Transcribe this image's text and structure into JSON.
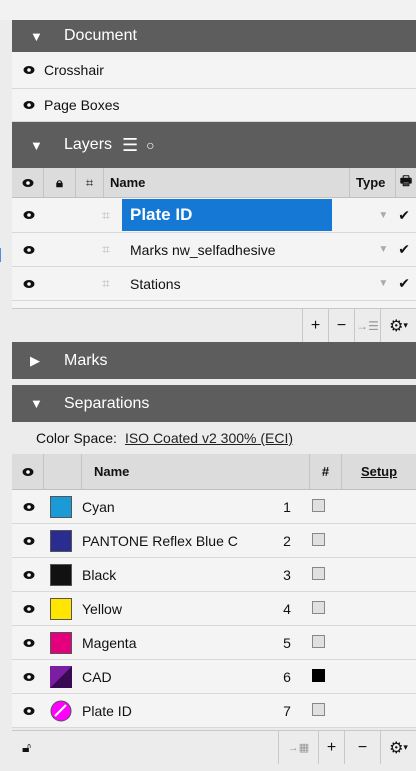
{
  "document": {
    "title": "Document",
    "items": [
      "Crosshair",
      "Page Boxes"
    ]
  },
  "layers": {
    "title": "Layers",
    "columns": {
      "name": "Name",
      "type": "Type"
    },
    "rows": [
      {
        "name": "Plate ID",
        "selected": true
      },
      {
        "name": "Marks nw_selfadhesive",
        "selected": false
      },
      {
        "name": "Stations",
        "selected": false
      }
    ],
    "toolbar": {
      "add": "+",
      "remove": "−",
      "gear": "⚙"
    }
  },
  "marks": {
    "title": "Marks"
  },
  "separations": {
    "title": "Separations",
    "color_space_label": "Color Space:",
    "color_space_value": "ISO Coated v2 300% (ECI)",
    "columns": {
      "name": "Name",
      "num": "#",
      "setup": "Setup"
    },
    "rows": [
      {
        "name": "Cyan",
        "num": "1",
        "color": "#1a9bd7",
        "checked": false
      },
      {
        "name": "PANTONE Reflex Blue C",
        "num": "2",
        "color": "#2b2c8f",
        "checked": false
      },
      {
        "name": "Black",
        "num": "3",
        "color": "#111111",
        "checked": false
      },
      {
        "name": "Yellow",
        "num": "4",
        "color": "#ffe500",
        "checked": false
      },
      {
        "name": "Magenta",
        "num": "5",
        "color": "#e4007c",
        "checked": false
      },
      {
        "name": "CAD",
        "num": "6",
        "color": "#7a1fa2",
        "checked": true
      },
      {
        "name": "Plate ID",
        "num": "7",
        "color": "#ff00ff",
        "checked": false
      }
    ],
    "toolbar": {
      "add": "+",
      "remove": "−",
      "gear": "⚙"
    }
  },
  "colors": {
    "header": "#5d5d5d",
    "selection": "#1478d4",
    "row": "#f4f4f4"
  }
}
